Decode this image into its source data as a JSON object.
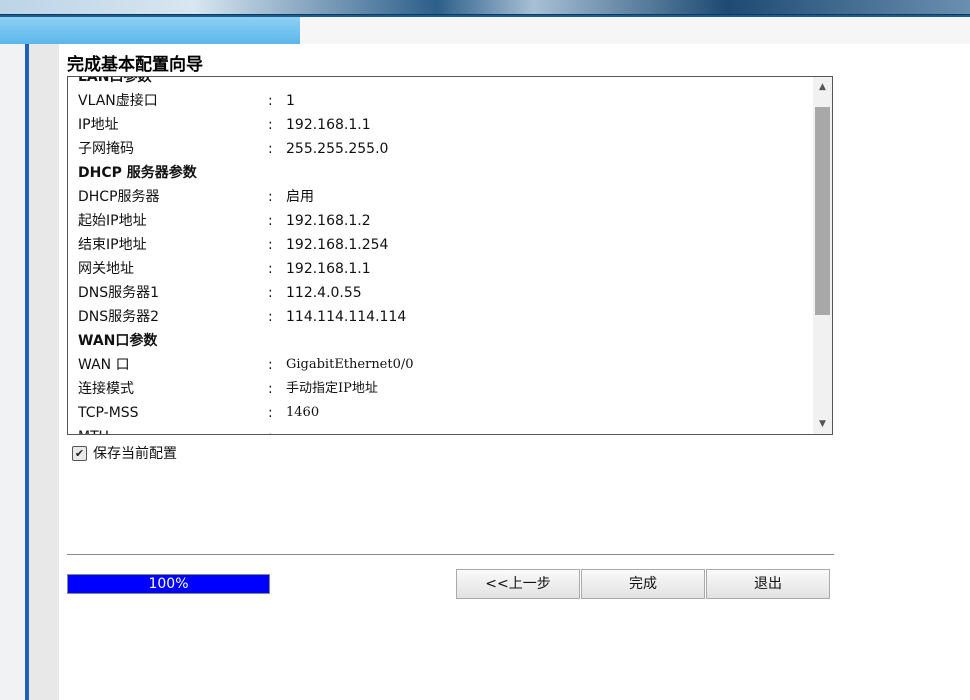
{
  "title": "完成基本配置向导",
  "summary": {
    "rows": [
      {
        "type": "section",
        "label": "LAN口参数"
      },
      {
        "label": "VLAN虚接口",
        "value": "1"
      },
      {
        "label": "IP地址",
        "value": "192.168.1.1"
      },
      {
        "label": "子网掩码",
        "value": "255.255.255.0"
      },
      {
        "type": "section",
        "label": "DHCP 服务器参数"
      },
      {
        "label": "DHCP服务器",
        "value": "启用"
      },
      {
        "label": "起始IP地址",
        "value": "192.168.1.2"
      },
      {
        "label": "结束IP地址",
        "value": "192.168.1.254"
      },
      {
        "label": "网关地址",
        "value": "192.168.1.1"
      },
      {
        "label": "DNS服务器1",
        "value": "112.4.0.55"
      },
      {
        "label": "DNS服务器2",
        "value": "114.114.114.114"
      },
      {
        "type": "section",
        "label": "WAN口参数"
      },
      {
        "label": "WAN 口",
        "value": "GigabitEthernet0/0",
        "mono": true
      },
      {
        "label": "连接模式",
        "value": "手动指定IP地址",
        "mono": true
      },
      {
        "label": "TCP-MSS",
        "value": "1460",
        "mono": true
      },
      {
        "label": "MTU",
        "value": ""
      }
    ],
    "separator": ":"
  },
  "save_config": {
    "label": "保存当前配置",
    "checked": true
  },
  "progress": {
    "percent": 100,
    "text": "100%"
  },
  "buttons": {
    "prev": "<<上一步",
    "finish": "完成",
    "exit": "退出"
  },
  "colors": {
    "progress_fill": "#0000ff",
    "rail_accent": "#1e63b8",
    "tab_active": "#5ab7eb"
  }
}
